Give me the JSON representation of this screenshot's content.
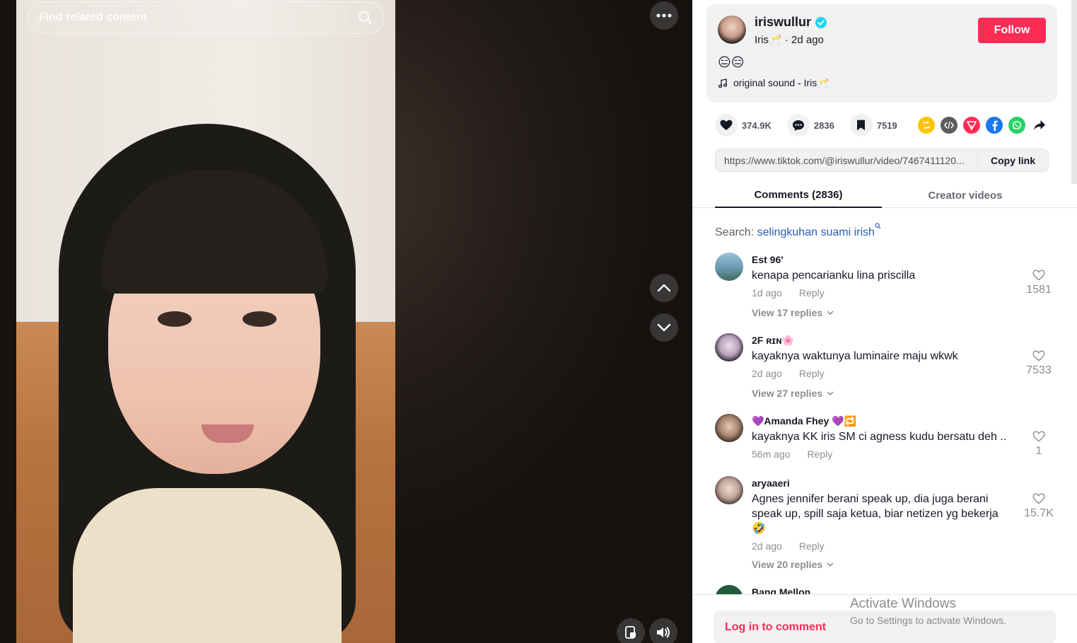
{
  "search": {
    "placeholder": "Find related content"
  },
  "author": {
    "username": "iriswullur",
    "nickname_date": "Iris🥂 · 2d ago",
    "follow_label": "Follow",
    "description": "😑😑",
    "music": "original sound - Iris🥂"
  },
  "stats": {
    "likes": "374.9K",
    "comments": "2836",
    "saves": "7519"
  },
  "link": {
    "url": "https://www.tiktok.com/@iriswullur/video/7467411120...",
    "copy_label": "Copy link"
  },
  "tabs": {
    "comments": "Comments (2836)",
    "creator": "Creator videos"
  },
  "related_search": {
    "label": "Search: ",
    "query": "selingkuhan suami irish"
  },
  "comments": [
    {
      "user": "Est 96'",
      "text": "kenapa pencarianku lina priscilla",
      "time": "1d ago",
      "reply": "Reply",
      "likes": "1581",
      "replies": "View 17 replies"
    },
    {
      "user": "2F ʀɪɴ🌸",
      "text": "kayaknya waktunya luminaire maju wkwk",
      "time": "2d ago",
      "reply": "Reply",
      "likes": "7533",
      "replies": "View 27 replies"
    },
    {
      "user": "💜Amanda Fhey 💜🔁",
      "text": "kayaknya KK iris SM ci agness kudu bersatu deh ..",
      "time": "56m ago",
      "reply": "Reply",
      "likes": "1",
      "replies": ""
    },
    {
      "user": "aryaaeri",
      "text": "Agnes jennifer berani speak up, dia juga berani speak up, spill saja ketua, biar netizen yg bekerja 🤣",
      "time": "2d ago",
      "reply": "Reply",
      "likes": "15.7K",
      "replies": "View 20 replies"
    },
    {
      "user": "Bang Mellon"
    }
  ],
  "login": {
    "label": "Log in to comment"
  },
  "watermark": {
    "title": "Activate Windows",
    "subtitle": "Go to Settings to activate Windows."
  },
  "colors": {
    "accent": "#fe2c55",
    "link": "#2b5db9"
  }
}
